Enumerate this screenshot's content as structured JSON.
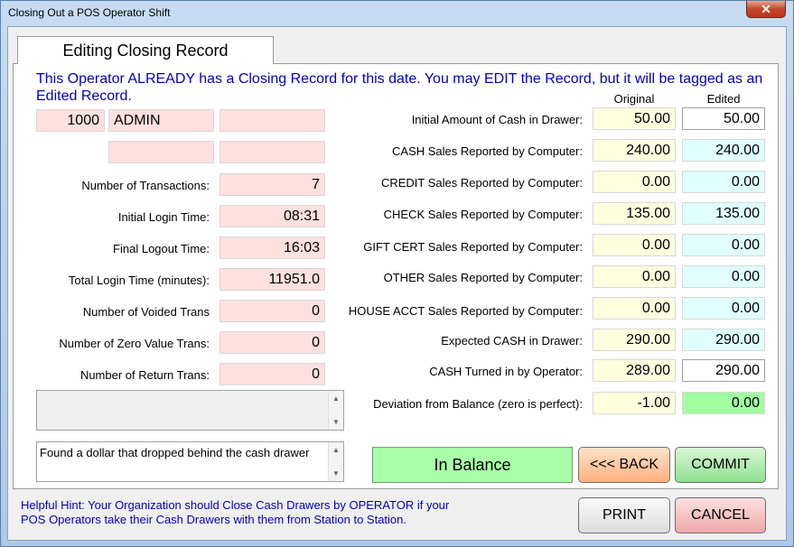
{
  "window": {
    "title": "Closing Out a POS Operator Shift",
    "close_glyph": "✕"
  },
  "tab": {
    "label": "Editing Closing Record"
  },
  "notice": "This Operator ALREADY has a Closing Record for this date.  You may EDIT the Record, but it will be tagged as an Edited Record.",
  "columns": {
    "original": "Original",
    "edited": "Edited"
  },
  "operator": {
    "id": "1000",
    "name": "ADMIN",
    "extra1": "",
    "extra2": "",
    "extra3": ""
  },
  "left_fields": [
    {
      "label": "Number of Transactions:",
      "value": "7"
    },
    {
      "label": "Initial Login Time:",
      "value": "08:31"
    },
    {
      "label": "Final Logout Time:",
      "value": "16:03"
    },
    {
      "label": "Total Login Time (minutes):",
      "value": "11951.0"
    },
    {
      "label": "Number of Voided Trans",
      "value": "0"
    },
    {
      "label": "Number of Zero Value Trans:",
      "value": "0"
    },
    {
      "label": "Number of Return Trans:",
      "value": "0"
    }
  ],
  "right_fields": [
    {
      "label": "Initial Amount of Cash in Drawer:",
      "original": "50.00",
      "edited": "50.00"
    },
    {
      "label": "CASH Sales Reported by Computer:",
      "original": "240.00",
      "edited": "240.00"
    },
    {
      "label": "CREDIT Sales Reported by Computer:",
      "original": "0.00",
      "edited": "0.00"
    },
    {
      "label": "CHECK Sales Reported by Computer:",
      "original": "135.00",
      "edited": "135.00"
    },
    {
      "label": "GIFT CERT Sales Reported by Computer:",
      "original": "0.00",
      "edited": "0.00"
    },
    {
      "label": "OTHER Sales Reported by Computer:",
      "original": "0.00",
      "edited": "0.00"
    },
    {
      "label": "HOUSE ACCT Sales Reported by Computer:",
      "original": "0.00",
      "edited": "0.00"
    },
    {
      "label": "Expected CASH in Drawer:",
      "original": "290.00",
      "edited": "290.00"
    },
    {
      "label": "CASH Turned in by Operator:",
      "original": "289.00",
      "edited": "290.00"
    },
    {
      "label": "Deviation from Balance (zero is perfect):",
      "original": "-1.00",
      "edited": "0.00"
    }
  ],
  "memo_top": "",
  "memo_note": "Found a dollar that dropped behind the cash drawer",
  "status": "In Balance",
  "buttons": {
    "back": "<<< BACK",
    "commit": "COMMIT",
    "print": "PRINT",
    "cancel": "CANCEL"
  },
  "hint": "Helpful Hint:  Your Organization should Close Cash Drawers by OPERATOR if your POS Operators take their Cash Drawers with them from Station to Station.",
  "colors": {
    "pink_field": "#ffe0e0",
    "yellow_field": "#ffffe0",
    "cyan_field": "#e0ffff",
    "green_field": "#a0ffa0",
    "notice_text": "#0000c0"
  }
}
